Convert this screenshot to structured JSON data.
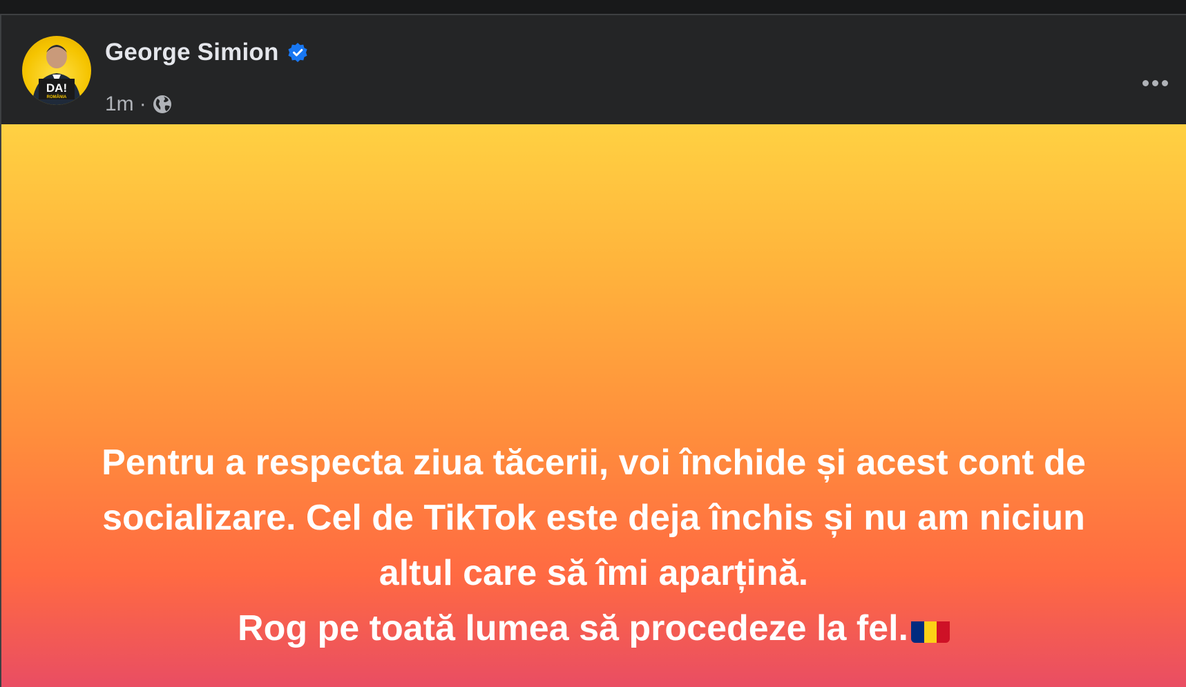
{
  "post": {
    "author": {
      "name": "George Simion",
      "verified": true,
      "avatar_text": "DA!",
      "avatar_subtext": "ROMÂNIA"
    },
    "timestamp": "1m",
    "separator": "·",
    "privacy_icon": "globe-icon",
    "more_icon": "more-options-icon",
    "text_lines": [
      "Pentru a respecta ziua tăcerii, voi închide și acest cont de",
      "socializare. Cel de TikTok este deja închis și nu am niciun",
      "altul care să îmi aparțină.",
      "Rog pe toată lumea să procedeze la fel."
    ],
    "emoji": "flag-romania",
    "background_gradient": [
      "#ffd142",
      "#ff8e3c",
      "#e94d63"
    ]
  },
  "colors": {
    "verified_blue": "#1877f2",
    "flag_blue": "#002b7f",
    "flag_yellow": "#fcd116",
    "flag_red": "#ce1126"
  }
}
